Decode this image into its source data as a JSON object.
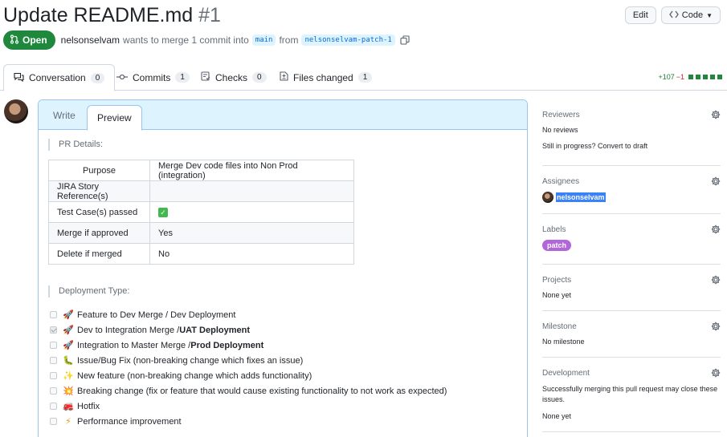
{
  "pr": {
    "title": "Update README.md",
    "number": "#1",
    "state": "Open",
    "author": "nelsonselvam",
    "merge_text": "wants to merge 1 commit into",
    "base_branch": "main",
    "from_text": "from",
    "head_branch": "nelsonselvam-patch-1"
  },
  "header_buttons": {
    "edit": "Edit",
    "code": "Code"
  },
  "tabs": [
    {
      "label": "Conversation",
      "count": "0"
    },
    {
      "label": "Commits",
      "count": "1"
    },
    {
      "label": "Checks",
      "count": "0"
    },
    {
      "label": "Files changed",
      "count": "1"
    }
  ],
  "diffstat": {
    "additions": "+107",
    "deletions": "−1"
  },
  "editor": {
    "write_tab": "Write",
    "preview_tab": "Preview"
  },
  "body": {
    "pr_details_heading": "PR Details:",
    "table": {
      "header": [
        "Purpose",
        "Merge Dev code files into Non Prod (integration)"
      ],
      "rows": [
        [
          "JIRA Story Reference(s)",
          ""
        ],
        [
          "Test Case(s) passed",
          "✓"
        ],
        [
          "Merge if approved",
          "Yes"
        ],
        [
          "Delete if merged",
          "No"
        ]
      ]
    },
    "deployment_heading": "Deployment Type:",
    "tasks": [
      {
        "checked": false,
        "icon": "rocket-icon",
        "text": "Feature to Dev Merge / Dev Deployment",
        "bold": ""
      },
      {
        "checked": true,
        "icon": "rocket-icon",
        "text": "Dev to Integration Merge / ",
        "bold": "UAT Deployment"
      },
      {
        "checked": false,
        "icon": "rocket-icon",
        "text": "Integration to Master Merge / ",
        "bold": "Prod Deployment"
      },
      {
        "checked": false,
        "icon": "bug-icon",
        "text": "Issue/Bug Fix (non-breaking change which fixes an issue)",
        "bold": ""
      },
      {
        "checked": false,
        "icon": "sparkles-icon",
        "text": "New feature (non-breaking change which adds functionality)",
        "bold": ""
      },
      {
        "checked": false,
        "icon": "boom-icon",
        "text": "Breaking change (fix or feature that would cause existing functionality to not work as expected)",
        "bold": ""
      },
      {
        "checked": false,
        "icon": "fire-engine-icon",
        "text": "Hotfix",
        "bold": ""
      },
      {
        "checked": false,
        "icon": "zap-icon",
        "text": "Performance improvement",
        "bold": ""
      }
    ]
  },
  "sidebar": {
    "reviewers": {
      "heading": "Reviewers",
      "value": "No reviews",
      "draft_prefix": "Still in progress?",
      "draft_link": "Convert to draft"
    },
    "assignees": {
      "heading": "Assignees",
      "user": "nelsonselvam"
    },
    "labels": {
      "heading": "Labels",
      "label": "patch",
      "label_color": "#b166d9"
    },
    "projects": {
      "heading": "Projects",
      "value": "None yet"
    },
    "milestone": {
      "heading": "Milestone",
      "value": "No milestone"
    },
    "development": {
      "heading": "Development",
      "note": "Successfully merging this pull request may close these issues.",
      "value": "None yet"
    }
  },
  "colors": {
    "open_green": "#1f883d",
    "link_blue": "#0969da",
    "preview_blue": "#ddf4ff"
  }
}
